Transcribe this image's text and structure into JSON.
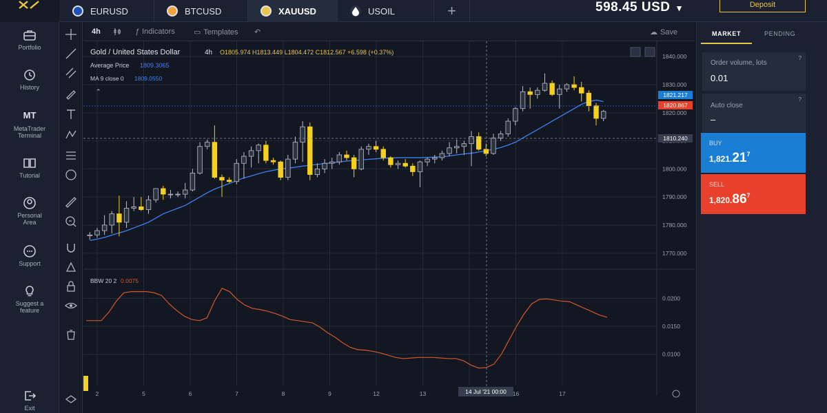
{
  "header": {
    "tabs": [
      {
        "label": "EURUSD",
        "icon": "eur-usd-flags-icon"
      },
      {
        "label": "BTCUSD",
        "icon": "bitcoin-icon"
      },
      {
        "label": "XAUUSD",
        "icon": "gold-usd-icon"
      },
      {
        "label": "USOIL",
        "icon": "oil-drop-icon"
      }
    ],
    "add_label": "+",
    "balance": "598.45 USD",
    "balance_chevron": "▾",
    "deposit_label": "Deposit"
  },
  "sidebar": {
    "items": [
      {
        "label": "Portfolio",
        "icon": "briefcase-icon"
      },
      {
        "label": "History",
        "icon": "history-icon"
      },
      {
        "label": "MetaTrader Terminal",
        "icon": "mt-icon",
        "badge": "MT"
      },
      {
        "label": "Tutorial",
        "icon": "book-icon"
      },
      {
        "label": "Personal Area",
        "icon": "user-icon"
      },
      {
        "label": "Support",
        "icon": "chat-icon"
      },
      {
        "label": "Suggest a feature",
        "icon": "bulb-icon"
      }
    ],
    "exit_label": "Exit"
  },
  "toolbar": {
    "timeframe": "4h",
    "indicators_label": "Indicators",
    "templates_label": "Templates",
    "save_label": "Save"
  },
  "chart": {
    "title": "Gold / United States Dollar",
    "interval": "4h",
    "ohlc": "O1805.974  H1813.449  L1804.472  C1812.567  +6.598 (+0.37%)",
    "avg_price_label": "Average Price",
    "avg_price_value": "1809.3065",
    "ma_label": "MA 9 close 0",
    "ma_value": "1809.0550",
    "bbw_label": "BBW 20 2",
    "bbw_value": "0.0075",
    "price_ticks": [
      "1840.000",
      "1830.000",
      "1820.000",
      "1810.000",
      "1800.000",
      "1790.000",
      "1780.000",
      "1770.000"
    ],
    "bbw_ticks": [
      "0.0200",
      "0.0150",
      "0.0100"
    ],
    "x_ticks": [
      "2",
      "5",
      "6",
      "7",
      "8",
      "9",
      "12",
      "13",
      "15",
      "16",
      "17"
    ],
    "crosshair_date": "14 Jul '21  00:00",
    "buy_price_tag": "1821.217",
    "sell_price_tag": "1820.867",
    "crosshair_price_tag": "1810.240",
    "colors": {
      "up": "#2c3240",
      "down": "#f5d020",
      "ma": "#3b82f6",
      "bbw": "#d4572a"
    }
  },
  "chart_data": {
    "type": "candlestick",
    "title": "Gold / United States Dollar",
    "ylim": [
      1767,
      1843
    ],
    "x": [
      "2",
      "5",
      "6",
      "7",
      "8",
      "9",
      "12",
      "13",
      "15",
      "16",
      "17"
    ],
    "series": [
      {
        "candles": [
          {
            "o": 1776.2,
            "h": 1777.5,
            "l": 1774.8,
            "c": 1776.5
          },
          {
            "o": 1776.5,
            "h": 1779.0,
            "l": 1775.5,
            "c": 1778.0
          },
          {
            "o": 1778.0,
            "h": 1783.5,
            "l": 1776.5,
            "c": 1780.0
          },
          {
            "o": 1780.0,
            "h": 1785.0,
            "l": 1777.0,
            "c": 1784.0
          },
          {
            "o": 1784.0,
            "h": 1790.5,
            "l": 1776.0,
            "c": 1781.0
          },
          {
            "o": 1781.0,
            "h": 1788.5,
            "l": 1779.0,
            "c": 1786.0
          },
          {
            "o": 1786.0,
            "h": 1790.0,
            "l": 1785.0,
            "c": 1786.5
          },
          {
            "o": 1786.5,
            "h": 1790.0,
            "l": 1785.0,
            "c": 1785.5
          },
          {
            "o": 1785.5,
            "h": 1790.5,
            "l": 1784.0,
            "c": 1789.0
          },
          {
            "o": 1789.0,
            "h": 1793.0,
            "l": 1788.0,
            "c": 1793.0
          },
          {
            "o": 1793.0,
            "h": 1794.0,
            "l": 1789.0,
            "c": 1791.0
          },
          {
            "o": 1791.0,
            "h": 1792.5,
            "l": 1789.5,
            "c": 1791.0
          },
          {
            "o": 1791.0,
            "h": 1792.0,
            "l": 1790.0,
            "c": 1791.0
          },
          {
            "o": 1791.0,
            "h": 1795.0,
            "l": 1789.5,
            "c": 1792.5
          },
          {
            "o": 1792.5,
            "h": 1800.0,
            "l": 1792.0,
            "c": 1798.5
          },
          {
            "o": 1798.5,
            "h": 1809.5,
            "l": 1798.0,
            "c": 1808.0
          },
          {
            "o": 1808.0,
            "h": 1810.5,
            "l": 1807.0,
            "c": 1809.5
          },
          {
            "o": 1809.5,
            "h": 1815.5,
            "l": 1796.5,
            "c": 1797.0
          },
          {
            "o": 1797.0,
            "h": 1798.0,
            "l": 1790.0,
            "c": 1796.0
          },
          {
            "o": 1796.0,
            "h": 1797.0,
            "l": 1795.0,
            "c": 1795.5
          },
          {
            "o": 1795.5,
            "h": 1803.5,
            "l": 1794.5,
            "c": 1802.0
          },
          {
            "o": 1802.0,
            "h": 1806.0,
            "l": 1796.5,
            "c": 1804.5
          },
          {
            "o": 1804.5,
            "h": 1808.0,
            "l": 1800.5,
            "c": 1806.5
          },
          {
            "o": 1806.5,
            "h": 1809.0,
            "l": 1802.0,
            "c": 1808.5
          },
          {
            "o": 1808.5,
            "h": 1810.0,
            "l": 1802.0,
            "c": 1803.0
          },
          {
            "o": 1803.0,
            "h": 1804.0,
            "l": 1801.5,
            "c": 1802.5
          },
          {
            "o": 1802.5,
            "h": 1803.0,
            "l": 1796.0,
            "c": 1797.0
          },
          {
            "o": 1797.0,
            "h": 1805.0,
            "l": 1796.0,
            "c": 1803.5
          },
          {
            "o": 1803.5,
            "h": 1811.5,
            "l": 1802.0,
            "c": 1809.5
          },
          {
            "o": 1809.5,
            "h": 1817.0,
            "l": 1802.5,
            "c": 1815.0
          },
          {
            "o": 1815.0,
            "h": 1816.5,
            "l": 1796.0,
            "c": 1798.0
          },
          {
            "o": 1798.0,
            "h": 1802.0,
            "l": 1797.0,
            "c": 1800.0
          },
          {
            "o": 1800.0,
            "h": 1803.5,
            "l": 1798.5,
            "c": 1802.0
          },
          {
            "o": 1802.0,
            "h": 1804.0,
            "l": 1800.0,
            "c": 1802.5
          },
          {
            "o": 1802.5,
            "h": 1806.0,
            "l": 1801.5,
            "c": 1805.0
          },
          {
            "o": 1805.0,
            "h": 1806.5,
            "l": 1803.0,
            "c": 1804.0
          },
          {
            "o": 1804.0,
            "h": 1805.0,
            "l": 1797.0,
            "c": 1800.0
          },
          {
            "o": 1800.0,
            "h": 1808.0,
            "l": 1799.5,
            "c": 1807.0
          },
          {
            "o": 1807.0,
            "h": 1809.0,
            "l": 1805.0,
            "c": 1808.0
          },
          {
            "o": 1808.0,
            "h": 1810.0,
            "l": 1806.0,
            "c": 1807.0
          },
          {
            "o": 1807.0,
            "h": 1808.0,
            "l": 1803.0,
            "c": 1804.0
          },
          {
            "o": 1804.0,
            "h": 1804.5,
            "l": 1800.5,
            "c": 1801.5
          },
          {
            "o": 1801.5,
            "h": 1803.0,
            "l": 1800.0,
            "c": 1802.0
          },
          {
            "o": 1802.0,
            "h": 1803.5,
            "l": 1800.5,
            "c": 1801.0
          },
          {
            "o": 1801.0,
            "h": 1802.0,
            "l": 1797.5,
            "c": 1799.0
          },
          {
            "o": 1799.0,
            "h": 1803.0,
            "l": 1793.5,
            "c": 1802.5
          },
          {
            "o": 1802.5,
            "h": 1804.0,
            "l": 1801.0,
            "c": 1803.5
          },
          {
            "o": 1803.5,
            "h": 1805.0,
            "l": 1802.0,
            "c": 1804.0
          },
          {
            "o": 1804.0,
            "h": 1806.5,
            "l": 1803.0,
            "c": 1805.5
          },
          {
            "o": 1805.5,
            "h": 1809.5,
            "l": 1804.5,
            "c": 1807.5
          },
          {
            "o": 1807.5,
            "h": 1810.5,
            "l": 1805.5,
            "c": 1808.0
          },
          {
            "o": 1808.0,
            "h": 1810.0,
            "l": 1805.0,
            "c": 1809.0
          },
          {
            "o": 1809.0,
            "h": 1813.5,
            "l": 1801.0,
            "c": 1811.5
          },
          {
            "o": 1811.5,
            "h": 1813.0,
            "l": 1806.5,
            "c": 1807.0
          },
          {
            "o": 1807.0,
            "h": 1809.0,
            "l": 1804.5,
            "c": 1805.5
          },
          {
            "o": 1805.5,
            "h": 1812.5,
            "l": 1805.0,
            "c": 1811.0
          },
          {
            "o": 1811.0,
            "h": 1813.5,
            "l": 1810.0,
            "c": 1812.5
          },
          {
            "o": 1812.5,
            "h": 1818.0,
            "l": 1811.5,
            "c": 1817.0
          },
          {
            "o": 1817.0,
            "h": 1822.0,
            "l": 1815.5,
            "c": 1821.5
          },
          {
            "o": 1821.5,
            "h": 1829.5,
            "l": 1820.5,
            "c": 1827.5
          },
          {
            "o": 1827.5,
            "h": 1829.0,
            "l": 1821.5,
            "c": 1826.5
          },
          {
            "o": 1826.5,
            "h": 1829.0,
            "l": 1825.0,
            "c": 1828.0
          },
          {
            "o": 1828.0,
            "h": 1834.0,
            "l": 1827.5,
            "c": 1830.5
          },
          {
            "o": 1830.5,
            "h": 1831.5,
            "l": 1826.0,
            "c": 1826.5
          },
          {
            "o": 1826.5,
            "h": 1830.0,
            "l": 1821.5,
            "c": 1828.5
          },
          {
            "o": 1828.5,
            "h": 1830.5,
            "l": 1827.5,
            "c": 1830.0
          },
          {
            "o": 1830.0,
            "h": 1833.0,
            "l": 1828.0,
            "c": 1829.0
          },
          {
            "o": 1829.0,
            "h": 1831.0,
            "l": 1824.0,
            "c": 1827.0
          },
          {
            "o": 1827.0,
            "h": 1828.0,
            "l": 1820.5,
            "c": 1822.5
          },
          {
            "o": 1822.5,
            "h": 1823.5,
            "l": 1815.5,
            "c": 1818.0
          },
          {
            "o": 1818.0,
            "h": 1821.0,
            "l": 1817.0,
            "c": 1820.5
          }
        ]
      },
      {
        "name": "MA 9 close 0",
        "values": [
          1774.5,
          1775.0,
          1775.6,
          1776.4,
          1777.2,
          1778.0,
          1779.0,
          1780.0,
          1781.0,
          1782.5,
          1784.0,
          1785.0,
          1786.0,
          1787.0,
          1788.5,
          1790.0,
          1791.5,
          1792.8,
          1793.8,
          1794.8,
          1795.8,
          1796.8,
          1797.5,
          1798.3,
          1799.0,
          1799.5,
          1800.0,
          1800.3,
          1800.6,
          1801.0,
          1801.3,
          1801.6,
          1801.9,
          1802.2,
          1802.5,
          1802.8,
          1803.0,
          1803.2,
          1803.4,
          1803.6,
          1803.8,
          1803.9,
          1804.0,
          1804.0,
          1804.0,
          1804.0,
          1804.1,
          1804.2,
          1804.3,
          1804.6,
          1805.0,
          1805.3,
          1805.6,
          1806.0,
          1806.5,
          1807.0,
          1807.6,
          1808.5,
          1809.5,
          1811.0,
          1812.5,
          1814.0,
          1815.5,
          1817.0,
          1818.5,
          1820.0,
          1821.5,
          1823.0,
          1824.0,
          1824.5,
          1824.0
        ]
      },
      {
        "name": "BBW 20 2",
        "values": [
          0.016,
          0.016,
          0.016,
          0.0175,
          0.0195,
          0.021,
          0.0212,
          0.0212,
          0.0212,
          0.021,
          0.0205,
          0.019,
          0.0178,
          0.0168,
          0.0162,
          0.016,
          0.0165,
          0.0195,
          0.0218,
          0.0212,
          0.0198,
          0.0188,
          0.0182,
          0.018,
          0.0177,
          0.0173,
          0.0168,
          0.0162,
          0.016,
          0.0158,
          0.0156,
          0.0148,
          0.0138,
          0.013,
          0.012,
          0.0112,
          0.0108,
          0.0107,
          0.0105,
          0.0102,
          0.0098,
          0.0094,
          0.0092,
          0.0093,
          0.0094,
          0.0094,
          0.0094,
          0.0093,
          0.0092,
          0.0092,
          0.0088,
          0.008,
          0.0075,
          0.0076,
          0.0082,
          0.01,
          0.0125,
          0.015,
          0.0172,
          0.019,
          0.0198,
          0.0199,
          0.0197,
          0.0195,
          0.0194,
          0.0188,
          0.0182,
          0.0176,
          0.017,
          0.0166
        ]
      }
    ]
  },
  "right_panel": {
    "tabs": [
      "MARKET",
      "PENDING"
    ],
    "order_volume_label": "Order volume, lots",
    "order_volume_value": "0.01",
    "auto_close_label": "Auto close",
    "auto_close_value": "–",
    "buy": {
      "label": "BUY",
      "price_main": "1,821.",
      "price_big": "21",
      "price_sup": "7",
      "color": "#1a7fd4"
    },
    "sell": {
      "label": "SELL",
      "price_main": "1,820.",
      "price_big": "86",
      "price_sup": "7",
      "color": "#e8402a"
    }
  }
}
